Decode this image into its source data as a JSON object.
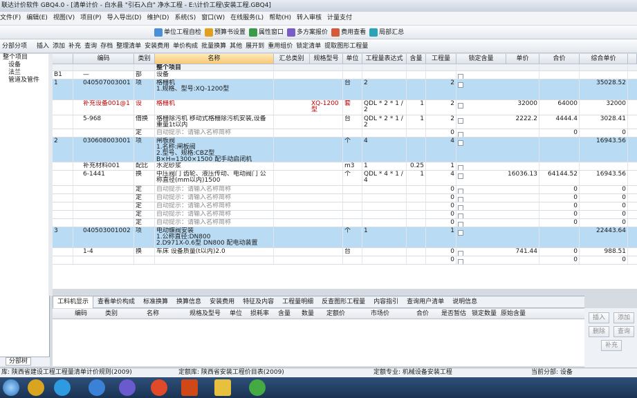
{
  "window": {
    "title": "联达计价软件 GBQ4.0 - [清单计价 - 白水县 \"引石入白\" 净水工程 - E:\\计价工程\\安装工程.GBQ4]"
  },
  "menu": [
    "文件(F)",
    "编辑(E)",
    "视图(V)",
    "项目(P)",
    "导入导出(D)",
    "维护(D)",
    "系统(S)",
    "窗口(W)",
    "在线服务(L)",
    "帮助(H)",
    "转入审核",
    "计量支付"
  ],
  "toolbar1": [
    "单位工程自检",
    "预算书设置",
    "属性窗口",
    "多方案报价",
    "费用查看",
    "局部汇总"
  ],
  "toolbar2": [
    "分部分项",
    "插入",
    "添加",
    "补充",
    "查询",
    "存档",
    "整理清单",
    "安装费用",
    "单价构成",
    "批量换算",
    "其他",
    "展开到",
    "重用组价",
    "锁定清单",
    "提取图形工程量"
  ],
  "tree": [
    "整个项目",
    "设备",
    "法兰",
    "管道及管件"
  ],
  "columns": [
    "编码",
    "类别",
    "名称",
    "汇总类别",
    "规格型号",
    "单位",
    "工程量表达式",
    "含量",
    "工程量",
    "锁定含量",
    "单价",
    "合价",
    "综合单价"
  ],
  "rows": [
    {
      "no": "",
      "code": "",
      "type": "",
      "name": "整个项目",
      "spec": "",
      "unit": "",
      "expr": "",
      "qty": "",
      "gc": "",
      "price": "",
      "total": "",
      "comp": "",
      "style": "hdr"
    },
    {
      "no": "B1",
      "code": "—",
      "type": "部",
      "name": "设备",
      "spec": "",
      "unit": "",
      "expr": "",
      "qty": "",
      "gc": "",
      "price": "",
      "total": "",
      "comp": "",
      "style": "plain"
    },
    {
      "no": "1",
      "code": "040507003001",
      "type": "项",
      "name": "格栅机\n1.规格、型号:XQ-1200型",
      "spec": "",
      "unit": "台",
      "expr": "2",
      "qty": "",
      "gc": "2",
      "price": "",
      "total": "",
      "comp": "35028.52",
      "style": "blue"
    },
    {
      "no": "",
      "code": "补充设备001@1",
      "type": "设",
      "name": "格栅机",
      "spec": "XQ-1200型",
      "unit": "套",
      "expr": "QDL * 2 * 1 / 2",
      "qty": "1",
      "gc": "2",
      "price": "32000",
      "total": "64000",
      "comp": "32000",
      "style": "red"
    },
    {
      "no": "",
      "code": "5-968",
      "type": "借换",
      "name": "格栅除污机 移动式格栅除污机安装,设备重量1t以内",
      "spec": "",
      "unit": "台",
      "expr": "QDL * 2 * 1 / 2",
      "qty": "1",
      "gc": "2",
      "price": "2222.2",
      "total": "4444.4",
      "comp": "3028.41",
      "style": "plain"
    },
    {
      "no": "",
      "code": "",
      "type": "定",
      "name": "自动提示：请输入名称简称",
      "spec": "",
      "unit": "",
      "expr": "",
      "qty": "",
      "gc": "0",
      "price": "",
      "total": "0",
      "comp": "0",
      "style": "hint"
    },
    {
      "no": "2",
      "code": "030608003001",
      "type": "项",
      "name": "闸板阀\n1.名称:闸板阀\n2.型号、规格:CBZ型 B×H=1300×1500 配手动启闭机",
      "spec": "",
      "unit": "个",
      "expr": "4",
      "qty": "",
      "gc": "4",
      "price": "",
      "total": "",
      "comp": "16943.56",
      "style": "blue"
    },
    {
      "no": "",
      "code": "补充材料001",
      "type": "配比",
      "name": "水泥砂浆",
      "spec": "",
      "unit": "m3",
      "expr": "1",
      "qty": "0.25",
      "gc": "1",
      "price": "",
      "total": "",
      "comp": "",
      "style": "plain"
    },
    {
      "no": "",
      "code": "6-1441",
      "type": "换",
      "name": "中压阀门 齿轮、液压传动、电动阀门 公称直径(mm以内)1500",
      "spec": "",
      "unit": "个",
      "expr": "QDL * 4 * 1 / 4",
      "qty": "1",
      "gc": "4",
      "price": "16036.13",
      "total": "64144.52",
      "comp": "16943.56",
      "style": "plain"
    },
    {
      "no": "",
      "code": "",
      "type": "定",
      "name": "自动提示：请输入名称简称",
      "spec": "",
      "unit": "",
      "expr": "",
      "qty": "",
      "gc": "0",
      "price": "",
      "total": "0",
      "comp": "0",
      "style": "hint"
    },
    {
      "no": "",
      "code": "",
      "type": "定",
      "name": "自动提示：请输入名称简称",
      "spec": "",
      "unit": "",
      "expr": "",
      "qty": "",
      "gc": "0",
      "price": "",
      "total": "0",
      "comp": "0",
      "style": "hint"
    },
    {
      "no": "",
      "code": "",
      "type": "定",
      "name": "自动提示：请输入名称简称",
      "spec": "",
      "unit": "",
      "expr": "",
      "qty": "",
      "gc": "0",
      "price": "",
      "total": "0",
      "comp": "0",
      "style": "hint"
    },
    {
      "no": "",
      "code": "",
      "type": "定",
      "name": "自动提示：请输入名称简称",
      "spec": "",
      "unit": "",
      "expr": "",
      "qty": "",
      "gc": "0",
      "price": "",
      "total": "0",
      "comp": "0",
      "style": "hint"
    },
    {
      "no": "",
      "code": "",
      "type": "定",
      "name": "自动提示：请输入名称简称",
      "spec": "",
      "unit": "",
      "expr": "",
      "qty": "",
      "gc": "0",
      "price": "",
      "total": "0",
      "comp": "0",
      "style": "hint"
    },
    {
      "no": "3",
      "code": "040503001002",
      "type": "项",
      "name": "电动蝶阀安装\n1.公称直径:DN800\n2.D971X-0.6型 DN800 配电动装置",
      "spec": "",
      "unit": "个",
      "expr": "1",
      "qty": "",
      "gc": "1",
      "price": "",
      "total": "",
      "comp": "22443.64",
      "style": "blue"
    },
    {
      "no": "",
      "code": "1-4",
      "type": "换",
      "name": "车床 设备质量(t以内)2.0",
      "spec": "",
      "unit": "台",
      "expr": "",
      "qty": "",
      "gc": "0",
      "price": "741.44",
      "total": "0",
      "comp": "988.51",
      "style": "plain"
    },
    {
      "no": "",
      "code": "",
      "type": "",
      "name": "",
      "spec": "",
      "unit": "",
      "expr": "",
      "qty": "",
      "gc": "0",
      "price": "",
      "total": "0",
      "comp": "0",
      "style": "plain"
    }
  ],
  "bottom_tabs": [
    "工料机显示",
    "查看单价构成",
    "标准换算",
    "换算信息",
    "安装费用",
    "特征及内容",
    "工程量明细",
    "反查图形工程量",
    "内容指引",
    "查询用户清单",
    "说明信息"
  ],
  "sub_columns": [
    "编码",
    "类别",
    "名称",
    "规格及型号",
    "单位",
    "损耗率",
    "含量",
    "数量",
    "定额价",
    "市场价",
    "合价",
    "是否暂估",
    "锁定数量",
    "原始含量"
  ],
  "right_buttons": [
    "插入",
    "添加",
    "删除",
    "查询",
    "补充"
  ],
  "left_tabs": [
    "分部树"
  ],
  "status": {
    "left": "库: 陕西省建设工程工程量清单计价规则(2009)",
    "mid": "定额库: 陕西省安装工程价目表(2009)",
    "spec": "定额专业: 机械设备安装工程",
    "part": "当前分部: 设备"
  }
}
